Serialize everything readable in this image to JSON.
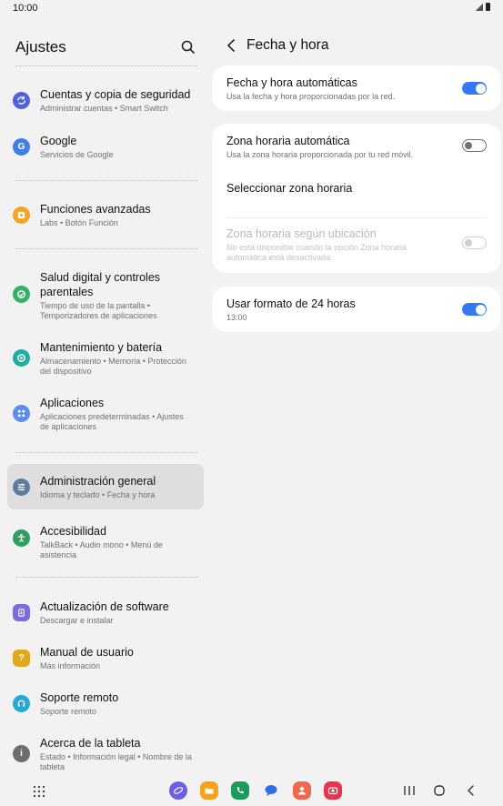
{
  "status_bar": {
    "time": "10:00"
  },
  "left_pane": {
    "title": "Ajustes",
    "items": [
      {
        "title": "Cuentas y copia de seguridad",
        "subtitle": "Administrar cuentas  •  Smart Switch",
        "icon": "sync-icon",
        "color": "#4e63d9"
      },
      {
        "title": "Google",
        "subtitle": "Servicios de Google",
        "icon": "google-icon",
        "color": "#3f7fe8"
      },
      {
        "title": "Funciones avanzadas",
        "subtitle": "Labs  •  Botón Función",
        "icon": "puzzle-icon",
        "color": "#f2a623"
      },
      {
        "title": "Salud digital y controles parentales",
        "subtitle": "Tiempo de uso de la pantalla  •  Temporizadores de aplicaciones",
        "icon": "digital-wellbeing-icon",
        "color": "#35b066"
      },
      {
        "title": "Mantenimiento y batería",
        "subtitle": "Almacenamiento  •  Memoria  •  Protección del dispositivo",
        "icon": "battery-care-icon",
        "color": "#1fae9e"
      },
      {
        "title": "Aplicaciones",
        "subtitle": "Aplicaciones predeterminadas  •  Ajustes de aplicaciones",
        "icon": "apps-icon",
        "color": "#5c8dec"
      },
      {
        "title": "Administración general",
        "subtitle": "Idioma y teclado  •  Fecha y hora",
        "icon": "sliders-icon",
        "color": "#5f7c9f"
      },
      {
        "title": "Accesibilidad",
        "subtitle": "TalkBack  •  Audio mono  •  Menú de asistencia",
        "icon": "accessibility-icon",
        "color": "#2f9e60"
      },
      {
        "title": "Actualización de software",
        "subtitle": "Descargar e instalar",
        "icon": "software-update-icon",
        "color": "#7b6cdb"
      },
      {
        "title": "Manual de usuario",
        "subtitle": "Más información",
        "icon": "manual-icon",
        "color": "#e0a81e"
      },
      {
        "title": "Soporte remoto",
        "subtitle": "Soporte remoto",
        "icon": "headset-icon",
        "color": "#26a8d8"
      },
      {
        "title": "Acerca de la tableta",
        "subtitle": "Estado  •  Información legal  •  Nombre de la tableta",
        "icon": "info-icon",
        "color": "#6d6d6d"
      }
    ]
  },
  "right_pane": {
    "title": "Fecha y hora",
    "auto_datetime": {
      "title": "Fecha y hora automáticas",
      "subtitle": "Usa la fecha y hora proporcionadas por la red.",
      "enabled": true
    },
    "auto_timezone": {
      "title": "Zona horaria automática",
      "subtitle": "Usa la zona horaria proporcionada por tu red móvil.",
      "enabled": false
    },
    "select_timezone": {
      "title": "Seleccionar zona horaria"
    },
    "location_timezone": {
      "title": "Zona horaria según ubicación",
      "subtitle": "No está disponible cuando la opción Zona horaria automática está desactivada.",
      "enabled": false
    },
    "format_24h": {
      "title": "Usar formato de 24 horas",
      "subtitle": "13:00",
      "enabled": true
    }
  },
  "colors": {
    "accent": "#3478f6",
    "background": "#f2f2f2",
    "selected": "#dedede"
  }
}
